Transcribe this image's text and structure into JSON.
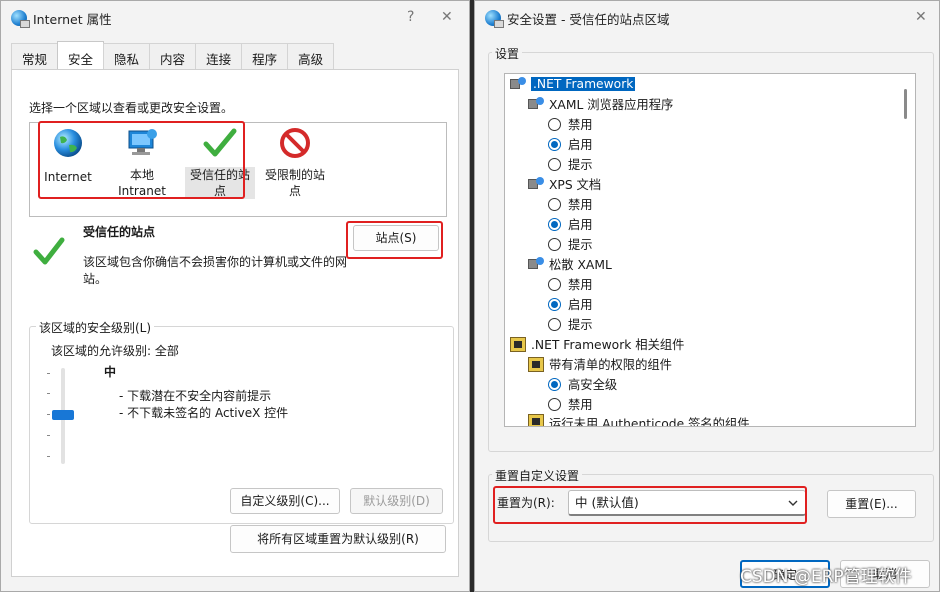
{
  "left_window": {
    "title": "Internet 属性",
    "help": "?",
    "close": "✕",
    "tabs": [
      "常规",
      "安全",
      "隐私",
      "内容",
      "连接",
      "程序",
      "高级"
    ],
    "zone_prompt": "选择一个区域以查看或更改安全设置。",
    "zones": {
      "internet": "Internet",
      "local_intranet_1": "本地",
      "local_intranet_2": "Intranet",
      "trusted_1": "受信任的站",
      "trusted_2": "点",
      "restricted_1": "受限制的站",
      "restricted_2": "点"
    },
    "selected_zone": {
      "name": "受信任的站点",
      "description_1": "该区域包含你确信不会损害你的计算机或文件的网",
      "description_2": "站。"
    },
    "sites_button": "站点(S)",
    "security_level": {
      "group_label": "该区域的安全级别(L)",
      "allowed_levels": "该区域的允许级别: 全部",
      "current_level": "中",
      "bullets": [
        "- 下载潜在不安全内容前提示",
        "- 不下载未签名的 ActiveX 控件"
      ]
    },
    "custom_level_button": "自定义级别(C)...",
    "default_level_button": "默认级别(D)",
    "reset_all_button": "将所有区域重置为默认级别(R)"
  },
  "right_window": {
    "title": "安全设置 - 受信任的站点区域",
    "close": "✕",
    "settings_group_label": "设置",
    "tree": [
      {
        "type": "category",
        "icon": "net",
        "label": ".NET Framework",
        "selected": true
      },
      {
        "type": "subcategory",
        "label": "XAML 浏览器应用程序"
      },
      {
        "type": "option",
        "label": "禁用",
        "checked": false
      },
      {
        "type": "option",
        "label": "启用",
        "checked": true
      },
      {
        "type": "option",
        "label": "提示",
        "checked": false
      },
      {
        "type": "subcategory",
        "label": "XPS 文档"
      },
      {
        "type": "option",
        "label": "禁用",
        "checked": false
      },
      {
        "type": "option",
        "label": "启用",
        "checked": true
      },
      {
        "type": "option",
        "label": "提示",
        "checked": false
      },
      {
        "type": "subcategory",
        "label": "松散 XAML"
      },
      {
        "type": "option",
        "label": "禁用",
        "checked": false
      },
      {
        "type": "option",
        "label": "启用",
        "checked": true
      },
      {
        "type": "option",
        "label": "提示",
        "checked": false
      },
      {
        "type": "category",
        "icon": "netcomp",
        "label": ".NET Framework 相关组件"
      },
      {
        "type": "subcategory",
        "icon": "netcomp",
        "label": "带有清单的权限的组件"
      },
      {
        "type": "option",
        "label": "高安全级",
        "checked": true
      },
      {
        "type": "option",
        "label": "禁用",
        "checked": false
      },
      {
        "type": "subcategory",
        "icon": "netcomp",
        "label": "运行未用 Authenticode 签名的组件"
      }
    ],
    "reset_group_label": "重置自定义设置",
    "reset_to_label": "重置为(R):",
    "reset_select_value": "中 (默认值)",
    "reset_button": "重置(E)...",
    "ok_button": "确定",
    "cancel_button": "取消"
  },
  "watermark": "CSDN @ERP管理软件",
  "colors": {
    "highlight_box": "#e02020",
    "selection": "#0067c0",
    "accent": "#1877d6"
  }
}
